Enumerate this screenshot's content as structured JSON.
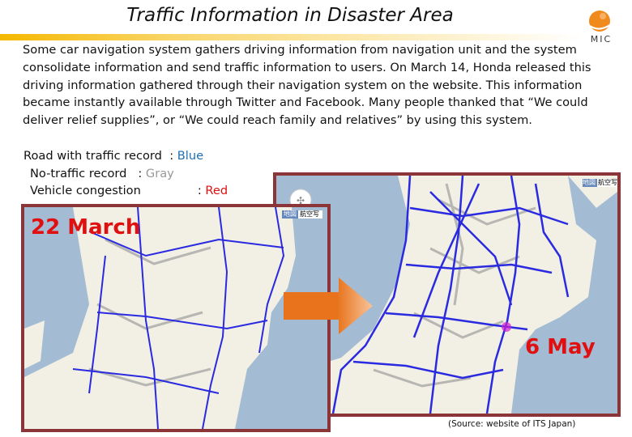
{
  "title": "Traffic Information in Disaster Area",
  "logo": {
    "text": "MIC",
    "color": "#f08a1c"
  },
  "body_lines": [
    "Some car navigation system gathers driving information from navigation unit and the system",
    "consolidate information and send traffic information to users. On March 14, Honda released this",
    "driving information gathered through their navigation system on the website. This information",
    "became instantly available through Twitter and Facebook. Many people thanked that “We could",
    "deliver relief supplies”, or “We could reach family and relatives” by using this system."
  ],
  "legend": [
    {
      "label": "Road with traffic record",
      "sep": ": ",
      "value": "Blue",
      "color": "#1f6fb5"
    },
    {
      "label": "No-traffic record",
      "sep": ": ",
      "value": "Gray",
      "color": "#999999"
    },
    {
      "label": "Vehicle congestion",
      "sep": ": ",
      "value": "Red",
      "color": "#e01010"
    }
  ],
  "maps": [
    {
      "date": "22 March",
      "map_type_buttons": [
        "地図",
        "航空写"
      ]
    },
    {
      "date": "6 May",
      "map_type_buttons": [
        "地図",
        "航空写"
      ]
    }
  ],
  "colors": {
    "road": "#2a2ae0",
    "land": "#f2efe4",
    "sea": "#a4bbd4",
    "frame": "#8b3538",
    "arrow": "#e8731c"
  },
  "source": "(Source:  website of ITS Japan)"
}
